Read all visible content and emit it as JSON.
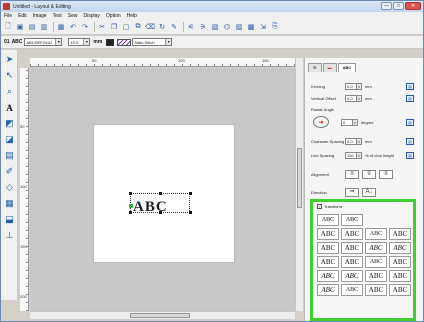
{
  "window": {
    "title": "Untitled - Layout & Editing",
    "buttons": [
      "—",
      "□",
      "✕"
    ]
  },
  "menu": [
    "File",
    "Edit",
    "Image",
    "Text",
    "Sew",
    "Display",
    "Option",
    "Help"
  ],
  "text_toolbar": {
    "font_number": "01",
    "font_name": "ABC",
    "font_combo": "ABCDEFGHIJ",
    "size_value": "10.0",
    "size_unit": "mm",
    "stitch_name": "Satin Stitch"
  },
  "rulers": {
    "top_labels": [
      "50",
      "100",
      "150"
    ],
    "left_labels": [
      "50",
      "100",
      "150",
      "200"
    ]
  },
  "canvas": {
    "design_text": "ABC"
  },
  "panel": {
    "tabs": [
      "",
      "",
      "ABC"
    ],
    "kerning": {
      "label": "Kerning",
      "value": "0.0",
      "unit": "mm"
    },
    "vertical_offset": {
      "label": "Vertical Offset",
      "value": "0.0",
      "unit": "mm"
    },
    "rotate": {
      "label": "Rotate Angle",
      "value": "0",
      "unit": "degree"
    },
    "char_spacing": {
      "label": "Character Spacing",
      "value": "0.0",
      "unit": "mm"
    },
    "line_spacing": {
      "label": "Line Spacing",
      "value": "100",
      "unit": "% of char height"
    },
    "alignment": {
      "label": "Alignment"
    },
    "direction": {
      "label": "Direction"
    },
    "transform": {
      "label": "Transform",
      "checked": true,
      "cells": [
        "ABC",
        "ABC",
        "",
        "",
        "ABC",
        "ABC",
        "ABC",
        "ABC",
        "ABC",
        "ABC",
        "ABC",
        "ABC",
        "ABC",
        "ABC",
        "ABC",
        "ABC",
        "ABC",
        "ABC",
        "ABC",
        "ABC",
        "ABC",
        "ABC",
        "ABC",
        "ABC"
      ]
    }
  },
  "colors": {
    "accent_green": "#3ed12f",
    "title_bar": "#c4d6ee",
    "start_point": "#2fae2f"
  }
}
